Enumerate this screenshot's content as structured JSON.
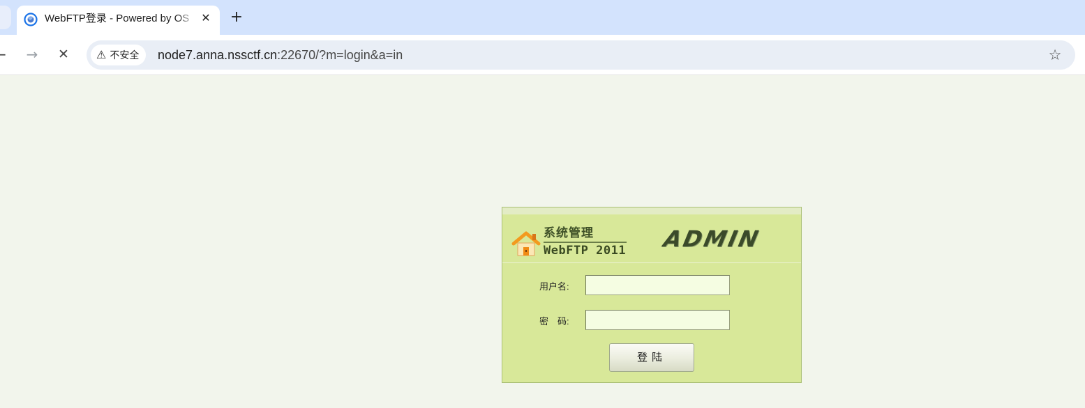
{
  "browser": {
    "tab": {
      "title": "WebFTP登录 - Powered by OS",
      "close_glyph": "✕"
    },
    "new_tab_glyph": "+",
    "nav": {
      "back_glyph": "←",
      "forward_glyph": "→",
      "stop_glyph": "✕"
    },
    "omnibox": {
      "security_label": "不安全",
      "warning_glyph": "⚠",
      "url_host": "node7.anna.nssctf.cn",
      "url_rest": ":22670/?m=login&a=in",
      "bookmark_glyph": "☆"
    },
    "prev_tab_glyph": "⌄"
  },
  "login": {
    "brand_title": "系统管理",
    "brand_sub": "WebFTP 2011",
    "admin_logo": "ADMIN",
    "username_label": "用户名:",
    "password_label": "密　码:",
    "username_value": "",
    "password_value": "",
    "submit_label": "登陆"
  },
  "icons": {
    "favicon": "globe-favicon-icon",
    "home": "home-icon"
  },
  "colors": {
    "tabstrip": "#d3e3fd",
    "page_bg": "#f2f5ec",
    "login_panel": "#d8e899",
    "input_bg": "#f5fde2"
  }
}
